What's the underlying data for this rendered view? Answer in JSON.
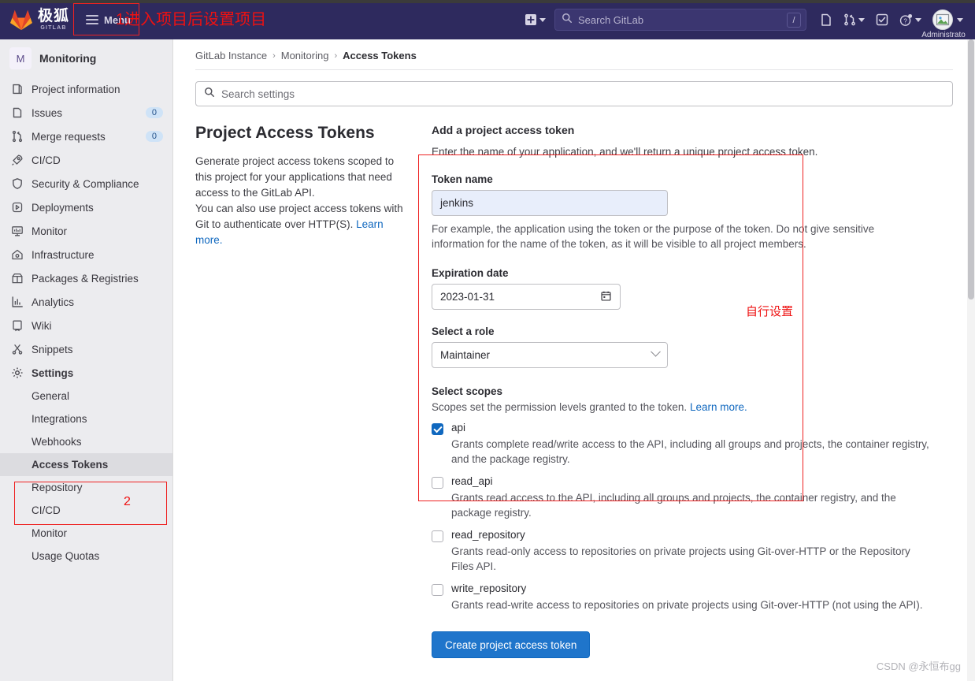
{
  "navbar": {
    "brand_cn": "极狐",
    "brand_en": "GITLAB",
    "menu_label": "Menu",
    "plus_icon": "plus-square-icon",
    "search_placeholder": "Search GitLab",
    "search_shortcut": "/",
    "issues_icon": "issues-icon",
    "merge_icon": "merge-requests-icon",
    "todos_icon": "todos-check-icon",
    "help_icon": "help-question-icon",
    "avatar_name": "Administrato"
  },
  "sidebar": {
    "project_initial": "M",
    "project_name": "Monitoring",
    "items": [
      {
        "label": "Project information",
        "icon": "project-info-icon",
        "badge": ""
      },
      {
        "label": "Issues",
        "icon": "issues-icon",
        "badge": "0"
      },
      {
        "label": "Merge requests",
        "icon": "merge-requests-icon",
        "badge": "0"
      },
      {
        "label": "CI/CD",
        "icon": "rocket-icon",
        "badge": ""
      },
      {
        "label": "Security & Compliance",
        "icon": "shield-icon",
        "badge": ""
      },
      {
        "label": "Deployments",
        "icon": "deployments-icon",
        "badge": ""
      },
      {
        "label": "Monitor",
        "icon": "monitor-icon",
        "badge": ""
      },
      {
        "label": "Infrastructure",
        "icon": "infrastructure-icon",
        "badge": ""
      },
      {
        "label": "Packages & Registries",
        "icon": "package-icon",
        "badge": ""
      },
      {
        "label": "Analytics",
        "icon": "analytics-icon",
        "badge": ""
      },
      {
        "label": "Wiki",
        "icon": "wiki-book-icon",
        "badge": ""
      },
      {
        "label": "Snippets",
        "icon": "snippets-scissors-icon",
        "badge": ""
      },
      {
        "label": "Settings",
        "icon": "gear-icon",
        "badge": ""
      }
    ],
    "sub_items": [
      {
        "label": "General",
        "active": false
      },
      {
        "label": "Integrations",
        "active": false
      },
      {
        "label": "Webhooks",
        "active": false
      },
      {
        "label": "Access Tokens",
        "active": true
      },
      {
        "label": "Repository",
        "active": false
      },
      {
        "label": "CI/CD",
        "active": false
      },
      {
        "label": "Monitor",
        "active": false
      },
      {
        "label": "Usage Quotas",
        "active": false
      }
    ]
  },
  "breadcrumb": {
    "items": [
      "GitLab Instance",
      "Monitoring",
      "Access Tokens"
    ],
    "separator": "›"
  },
  "settings_search": {
    "placeholder": "Search settings",
    "icon": "search-icon"
  },
  "left_panel": {
    "title": "Project Access Tokens",
    "paragraph_1": "Generate project access tokens scoped to this project for your applications that need access to the GitLab API.",
    "paragraph_2": "You can also use project access tokens with Git to authenticate over HTTP(S).",
    "learn_more": "Learn more."
  },
  "form": {
    "title": "Add a project access token",
    "subtitle": "Enter the name of your application, and we'll return a unique project access token.",
    "token_name_label": "Token name",
    "token_name_value": "jenkins",
    "token_name_help": "For example, the application using the token or the purpose of the token. Do not give sensitive information for the name of the token, as it will be visible to all project members.",
    "expiration_label": "Expiration date",
    "expiration_value": "2023-01-31",
    "calendar_icon": "calendar-icon",
    "role_label": "Select a role",
    "role_value": "Maintainer",
    "role_chevron": "chevron-down-icon",
    "scopes_title": "Select scopes",
    "scopes_subtitle": "Scopes set the permission levels granted to the token.",
    "scopes_learn_more": "Learn more.",
    "scopes": [
      {
        "name": "api",
        "checked": true,
        "description": "Grants complete read/write access to the API, including all groups and projects, the container registry, and the package registry."
      },
      {
        "name": "read_api",
        "checked": false,
        "description": "Grants read access to the API, including all groups and projects, the container registry, and the package registry."
      },
      {
        "name": "read_repository",
        "checked": false,
        "description": "Grants read-only access to repositories on private projects using Git-over-HTTP or the Repository Files API."
      },
      {
        "name": "write_repository",
        "checked": false,
        "description": "Grants read-write access to repositories on private projects using Git-over-HTTP (not using the API)."
      }
    ],
    "submit_label": "Create project access token"
  },
  "annotations": {
    "menu_note": "1进入项目后设置项目",
    "sidebar_step": "2",
    "expiration_note": "自行设置"
  },
  "watermark": "CSDN @永恒布gg",
  "colors": {
    "navbar_bg": "#2e2a5e",
    "sidebar_bg": "#ececef",
    "accent_blue": "#1f75cb",
    "link_blue": "#1068bf",
    "annotation_red": "#ee2222"
  }
}
